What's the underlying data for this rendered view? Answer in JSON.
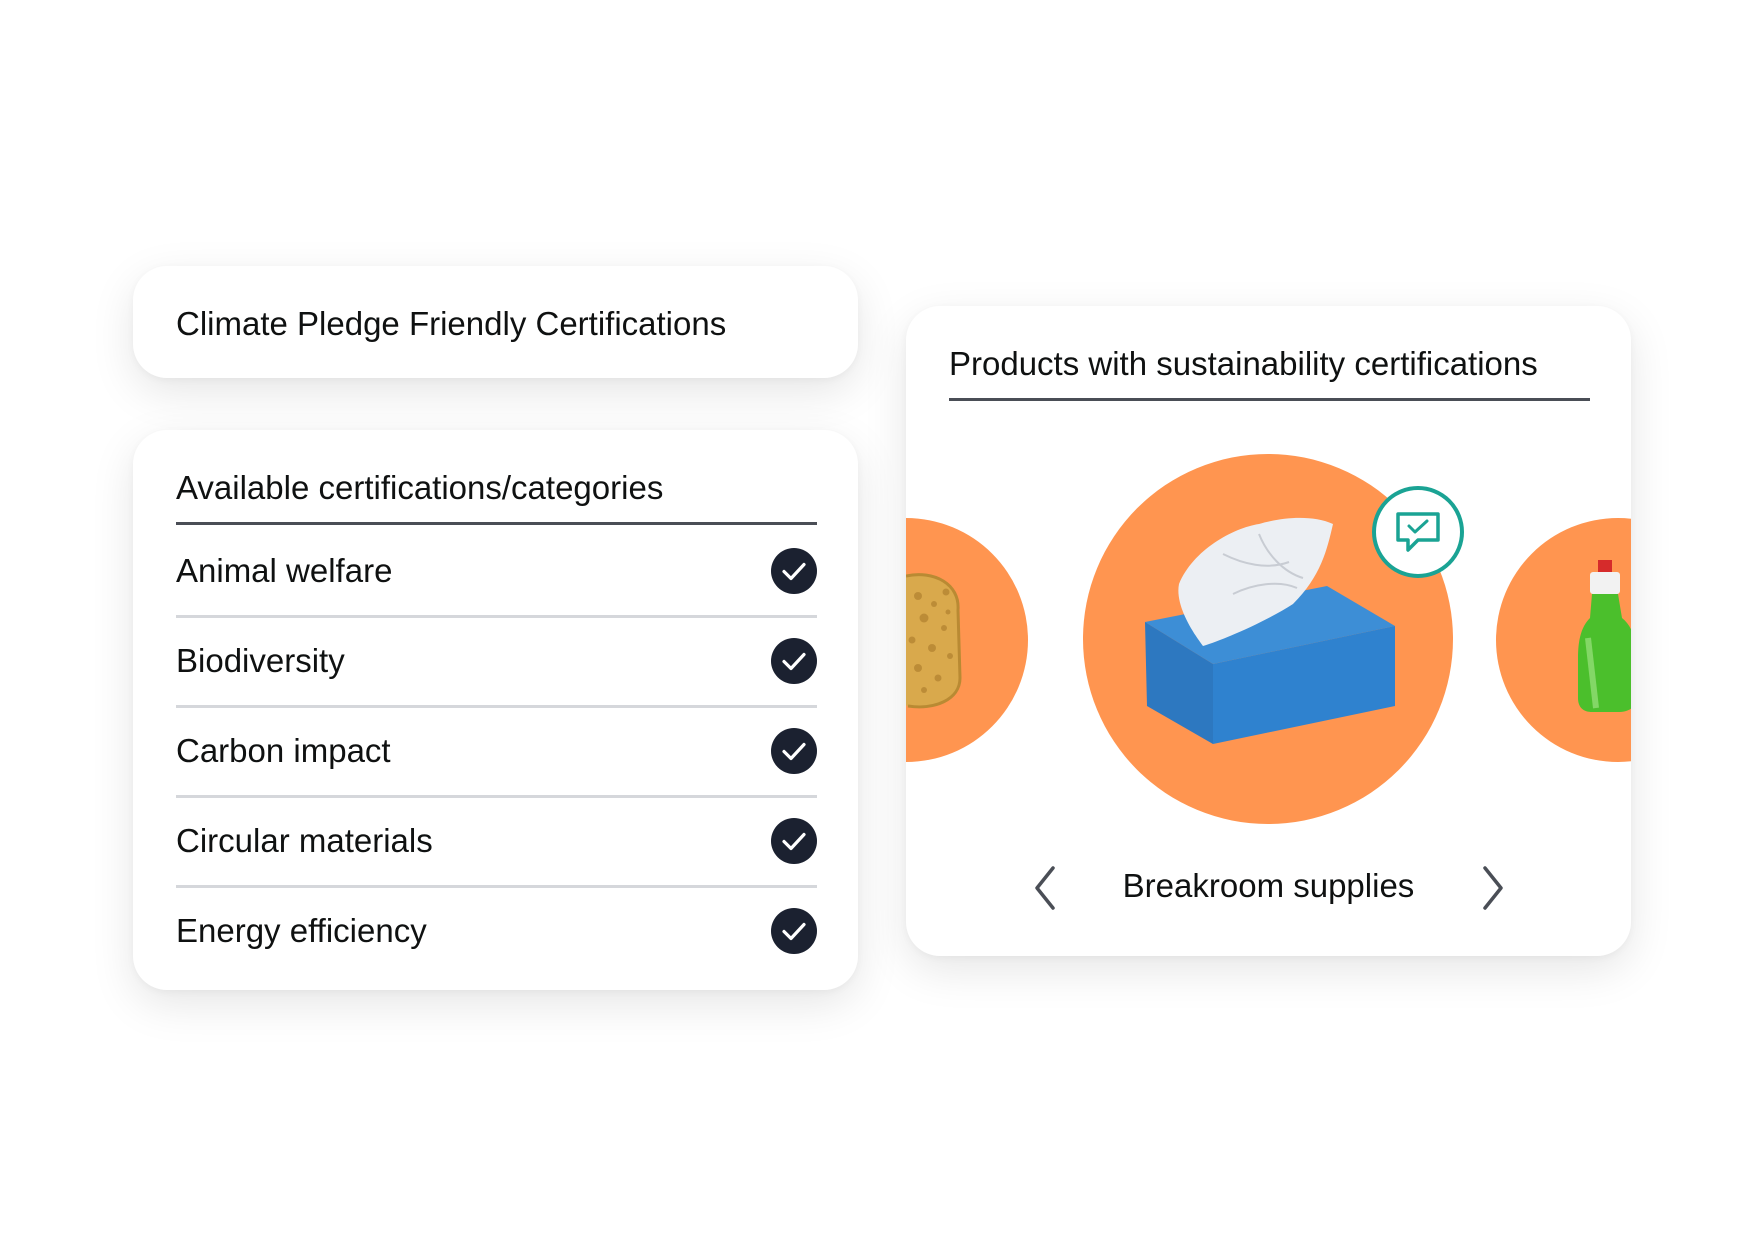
{
  "title_card": {
    "title": "Climate Pledge Friendly Certifications"
  },
  "certifications": {
    "heading": "Available certifications/categories",
    "items": [
      {
        "label": "Animal welfare",
        "checked": true
      },
      {
        "label": "Biodiversity",
        "checked": true
      },
      {
        "label": "Carbon impact",
        "checked": true
      },
      {
        "label": "Circular materials",
        "checked": true
      },
      {
        "label": "Energy efficiency",
        "checked": true
      }
    ]
  },
  "products": {
    "heading": "Products with sustainability certifications",
    "carousel": {
      "current_label": "Breakroom supplies",
      "items": [
        {
          "icon": "sponge-image"
        },
        {
          "icon": "tissue-box-image",
          "badge_icon": "verified-chat-icon"
        },
        {
          "icon": "dish-soap-bottle-image"
        }
      ]
    }
  },
  "colors": {
    "accent_orange": "#ff9550",
    "badge_teal": "#1aa394",
    "check_dark": "#1b2130",
    "rule_dark": "#4a4e56",
    "rule_light": "#d5d7db"
  }
}
